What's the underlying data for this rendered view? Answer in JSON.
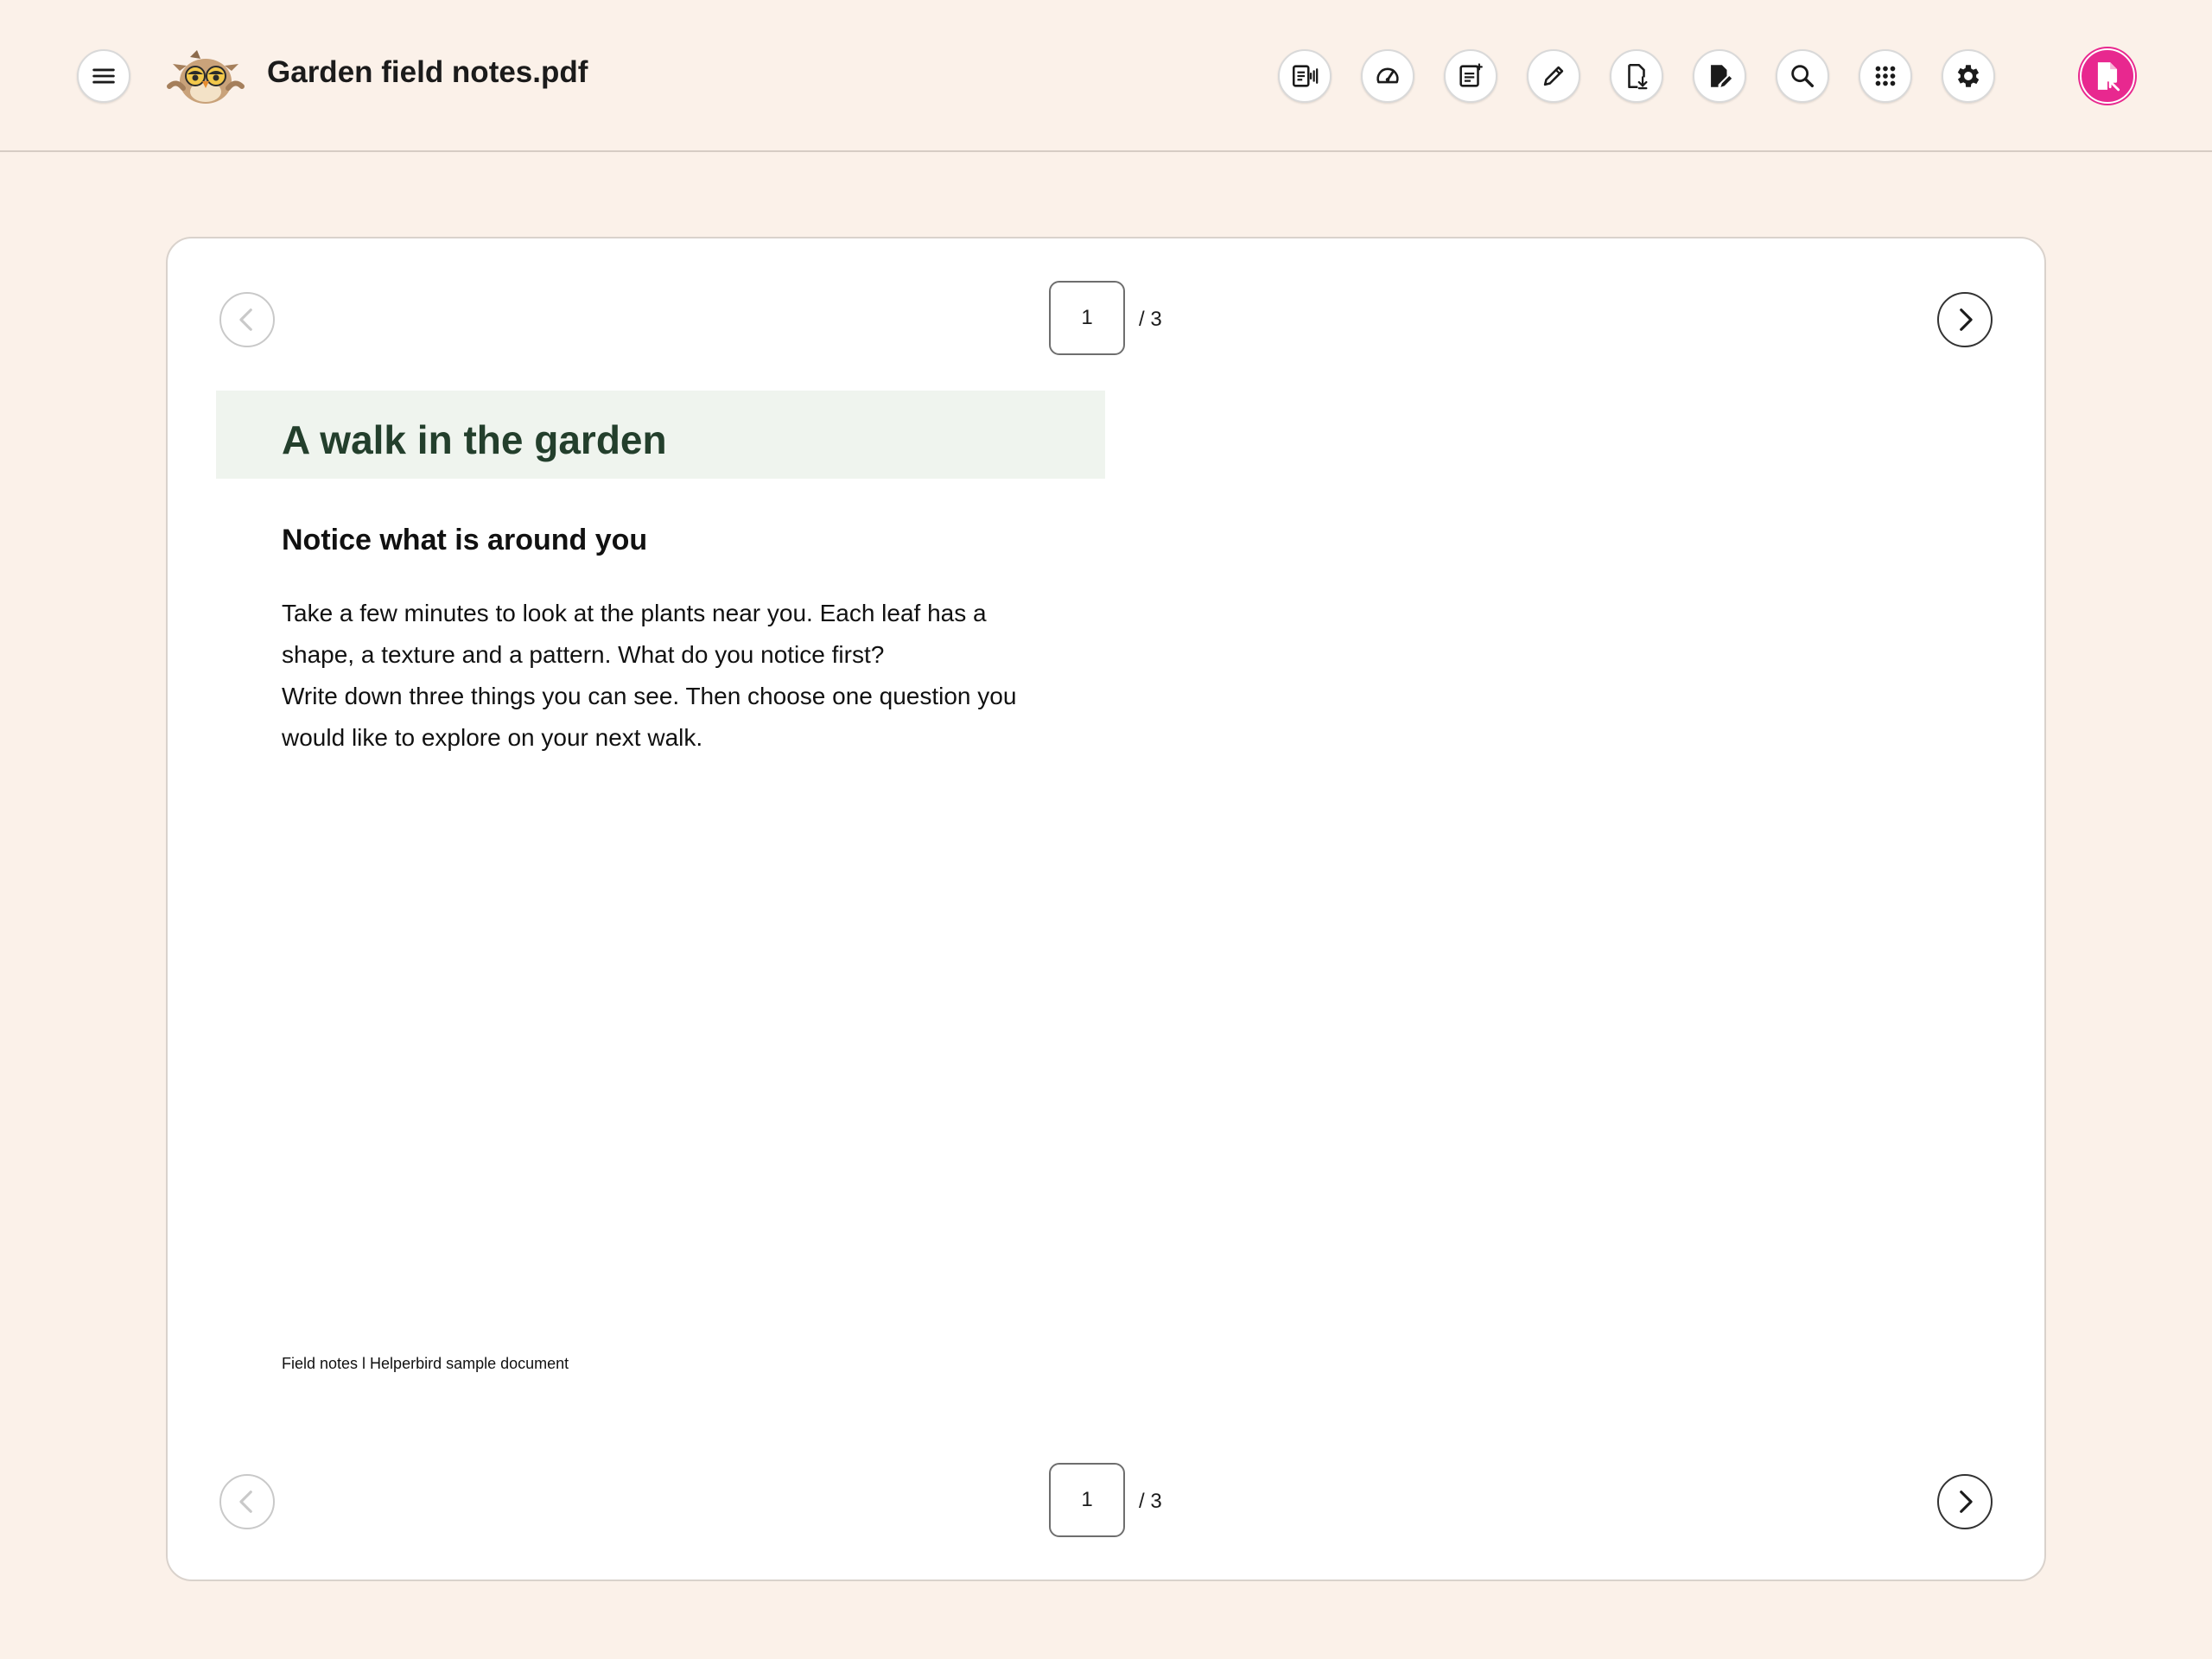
{
  "header": {
    "document_title": "Garden field notes.pdf",
    "logo_icon": "owl-logo-icon",
    "menu_icon": "hamburger-menu-icon"
  },
  "toolbar": {
    "buttons": [
      {
        "name": "text-to-speech-icon"
      },
      {
        "name": "speedometer-icon"
      },
      {
        "name": "summarise-icon"
      },
      {
        "name": "pencil-icon"
      },
      {
        "name": "download-file-icon"
      },
      {
        "name": "edit-document-icon"
      },
      {
        "name": "search-icon"
      },
      {
        "name": "apps-grid-icon"
      },
      {
        "name": "gear-icon"
      }
    ],
    "account": {
      "name": "pdf-reader-icon",
      "color": "#e8288f"
    }
  },
  "pager_top": {
    "current_page": "1",
    "total_label": "/ 3"
  },
  "pager_bottom": {
    "current_page": "1",
    "total_label": "/ 3"
  },
  "page": {
    "heading": "A walk in the garden",
    "subheading": "Notice what is around you",
    "paragraphs": [
      "Take a few minutes to look at the plants near you. Each leaf has a shape, a texture and a pattern. What do you notice first?",
      "Write down three things you can see. Then choose one question you would like to explore on your next walk."
    ],
    "footer": "Field notes l Helperbird sample document"
  },
  "colors": {
    "background": "#fbf1e9",
    "heading_green": "#233f2c",
    "title_band": "#eff4ee",
    "accent_pink": "#e8288f"
  }
}
